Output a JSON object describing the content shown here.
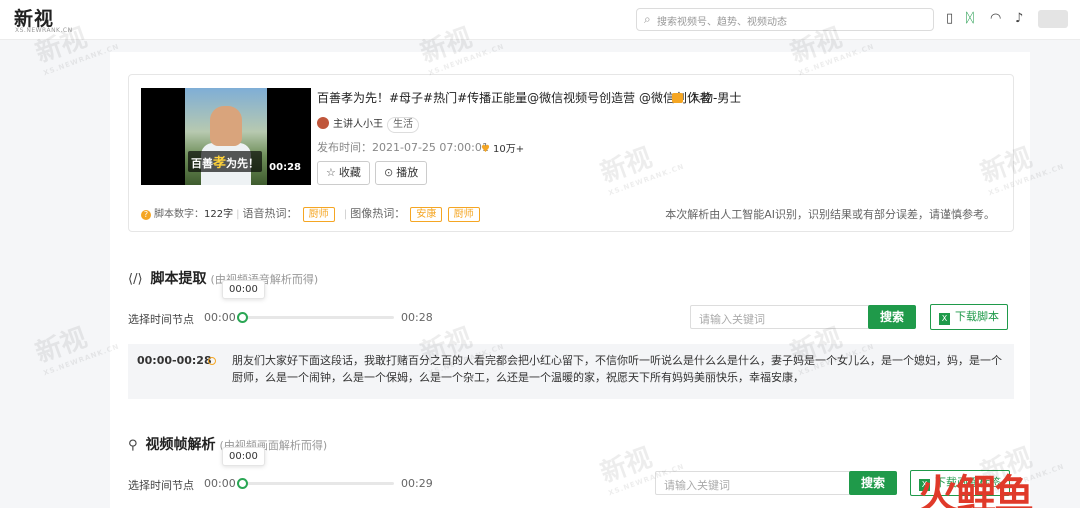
{
  "header": {
    "logo": "新视",
    "logo_sub": "XS.NEWRANK.CN",
    "search_placeholder": "搜索视频号、趋势、视频动态"
  },
  "video": {
    "title": "百善孝为先！#母子#热门#传播正能量@微信视频号创造营 @微信创作者",
    "category_tag": "人物-男士",
    "thumbnail_caption_pre": "百善",
    "thumbnail_caption_highlight": "孝",
    "thumbnail_caption_post": "为先！",
    "duration": "00:28",
    "author": "主讲人小王",
    "author_tag": "生活",
    "publish_time": "发布时间：2021-07-25 07:00:01",
    "likes": "10万+",
    "collect_label": "收藏",
    "play_label": "播放",
    "word_count_label": "脚本数字：",
    "word_count": "122字",
    "voice_hotword_label": "语音热词：",
    "voice_hotwords": [
      "厨师"
    ],
    "image_hotword_label": "图像热词：",
    "image_hotwords": [
      "安康",
      "厨师"
    ],
    "disclaimer": "本次解析由人工智能AI识别，识别结果或有部分误差，请谨慎参考。"
  },
  "script_section": {
    "title": "脚本提取",
    "subtitle": "(由视频语音解析而得)",
    "node_label": "选择时间节点",
    "time_start": "00:00",
    "time_end": "00:28",
    "tooltip": "00:00",
    "keyword_placeholder": "请输入关键词",
    "search_label": "搜索",
    "download_label": "下载脚本",
    "entry_range": "00:00-00:28",
    "entry_text": "朋友们大家好下面这段话，我敢打赌百分之百的人看完都会把小红心留下，不信你听一听说么是什么么是什么，妻子妈是一个女儿么，是一个媳妇，妈，是一个厨师，么是一个闹钟，么是一个保姆，么是一个杂工，么还是一个温暖的家，祝愿天下所有妈妈美丽快乐，幸福安康，"
  },
  "frame_section": {
    "title": "视频帧解析",
    "subtitle": "(由视频画面解析而得)",
    "node_label": "选择时间节点",
    "time_start": "00:00",
    "time_end": "00:29",
    "tooltip": "00:00",
    "keyword_placeholder": "请输入关键词",
    "search_label": "搜索",
    "download_label": "下载画面标签"
  },
  "watermark": {
    "text": "新视",
    "sub": "XS.NEWRANK.CN"
  },
  "corner_logo": "火鲤鱼",
  "colors": {
    "accent_green": "#1f9a4a",
    "accent_orange": "#f5a623"
  }
}
